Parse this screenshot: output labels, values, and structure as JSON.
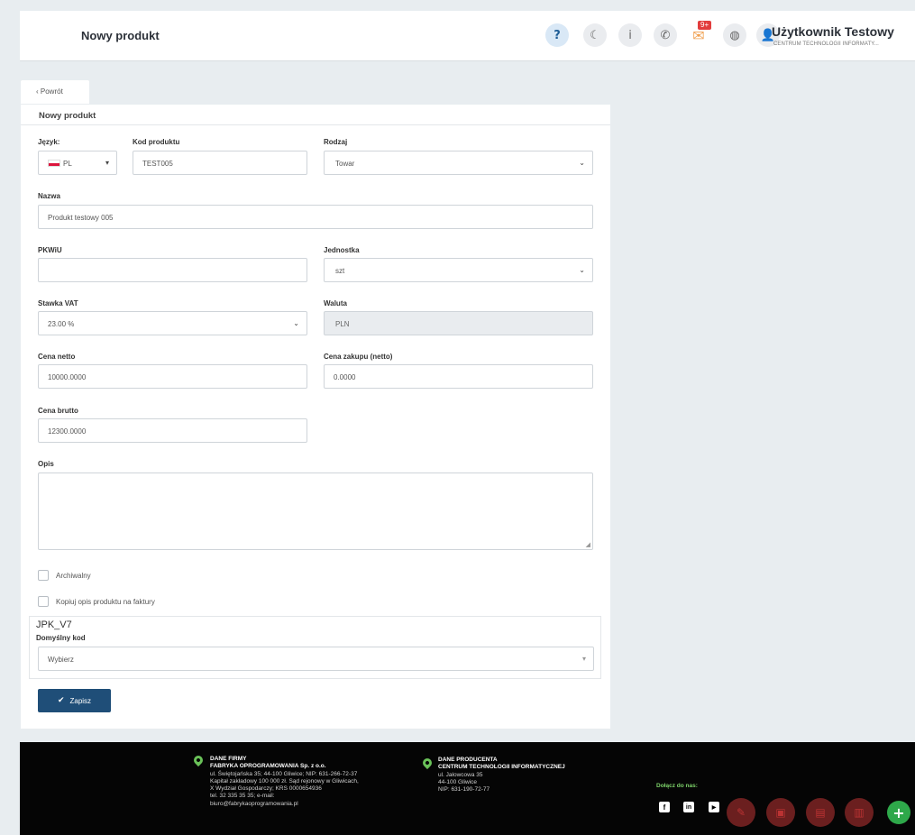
{
  "header": {
    "title": "Nowy produkt",
    "mail_badge": "9+",
    "user_name": "Użytkownik Testowy",
    "user_company": "CENTRUM TECHNOLOGII INFORMATY..."
  },
  "back_label": "‹  Powrót",
  "card_title": "Nowy produkt",
  "form": {
    "language_label": "Język:",
    "language_value": "PL",
    "code_label": "Kod produktu",
    "code_value": "TEST005",
    "type_label": "Rodzaj",
    "type_value": "Towar",
    "name_label": "Nazwa",
    "name_value": "Produkt testowy 005",
    "pkwiu_label": "PKWiU",
    "pkwiu_value": "",
    "unit_label": "Jednostka",
    "unit_value": "szt",
    "vat_label": "Stawka VAT",
    "vat_value": "23.00 %",
    "currency_label": "Waluta",
    "currency_value": "PLN",
    "net_label": "Cena netto",
    "net_value": "10000.0000",
    "purchase_label": "Cena zakupu (netto)",
    "purchase_value": "0.0000",
    "gross_label": "Cena brutto",
    "gross_value": "12300.0000",
    "desc_label": "Opis",
    "archived_label": "Archiwalny",
    "copy_desc_label": "Kopiuj opis produktu na faktury",
    "jpk_title": "JPK_V7",
    "default_code_label": "Domyślny kod",
    "default_code_value": "Wybierz",
    "save_label": "Zapisz"
  },
  "footer": {
    "company_heading": "DANE FIRMY",
    "company_name": "FABRYKA OPROGRAMOWANIA Sp. z o.o.",
    "company_line1": "ul. Świętojańska 35; 44-100 Gliwice; NIP: 631-266-72-37",
    "company_line2": "Kapitał zakładowy 100 000 zł. Sąd rejonowy w Gliwicach,",
    "company_line3": "X Wydział Gospodarczy; KRS 0000654936",
    "company_line4": "tel. 32 335 35 35; e-mail:",
    "company_line5": "biuro@fabrykaoprogramowania.pl",
    "producer_heading": "DANE PRODUCENTA",
    "producer_name": "CENTRUM TECHNOLOGII INFORMATYCZNEJ",
    "producer_line1": "ul. Jałowcowa 35",
    "producer_line2": "44-100 Gliwice",
    "producer_line3": "NIP: 631-190-72-77",
    "join_label": "Dołącz do nas:"
  },
  "icons": {
    "help": "?",
    "moon": "☾",
    "info": "i",
    "phone": "✆",
    "mail": "✉",
    "globe": "◍",
    "user": "👤",
    "facebook": "f",
    "linkedin": "in",
    "youtube": "▶",
    "fab1": "✎",
    "fab2": "▣",
    "fab3": "▤",
    "fab4": "▥",
    "fab_add": "+"
  },
  "colors": {
    "primary": "#1f4e78",
    "footer_accent": "#6ac259",
    "fab_add": "#2ea84a",
    "badge": "#e23d3d"
  }
}
